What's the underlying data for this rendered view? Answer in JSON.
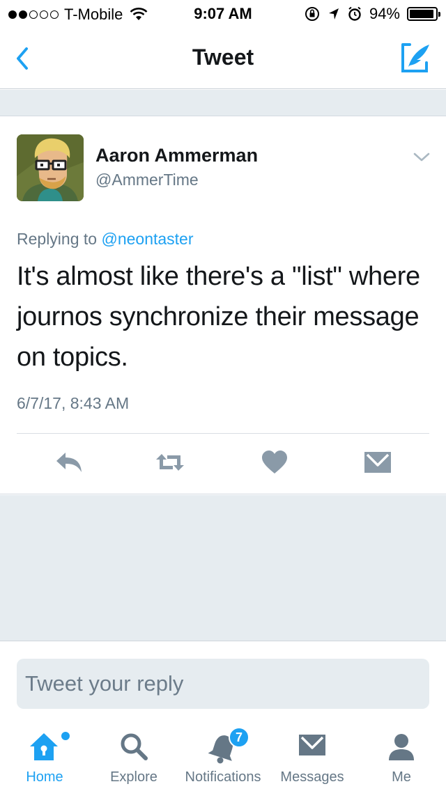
{
  "status_bar": {
    "carrier": "T-Mobile",
    "time": "9:07 AM",
    "battery": "94%",
    "battery_level": 0.94,
    "signal_bars": 2,
    "signal_total": 5
  },
  "nav": {
    "title": "Tweet",
    "accent": "#1da1f2"
  },
  "tweet": {
    "author_name": "Aaron Ammerman",
    "author_handle": "@AmmerTime",
    "replying_prefix": "Replying to",
    "replying_to": "@neontaster",
    "text": "It's almost like there's a \"list\" where journos synchronize their message on topics.",
    "timestamp": "6/7/17, 8:43 AM"
  },
  "reply": {
    "placeholder": "Tweet your reply"
  },
  "tabs": [
    {
      "label": "Home",
      "icon": "home-icon",
      "active": true
    },
    {
      "label": "Explore",
      "icon": "search-icon",
      "active": false
    },
    {
      "label": "Notifications",
      "icon": "bell-icon",
      "active": false,
      "badge": "7"
    },
    {
      "label": "Messages",
      "icon": "envelope-icon",
      "active": false
    },
    {
      "label": "Me",
      "icon": "person-icon",
      "active": false
    }
  ],
  "colors": {
    "accent": "#1da1f2",
    "secondary_text": "#657786",
    "action_icon": "#8a9aa8",
    "background_gray": "#e6ecf0"
  }
}
